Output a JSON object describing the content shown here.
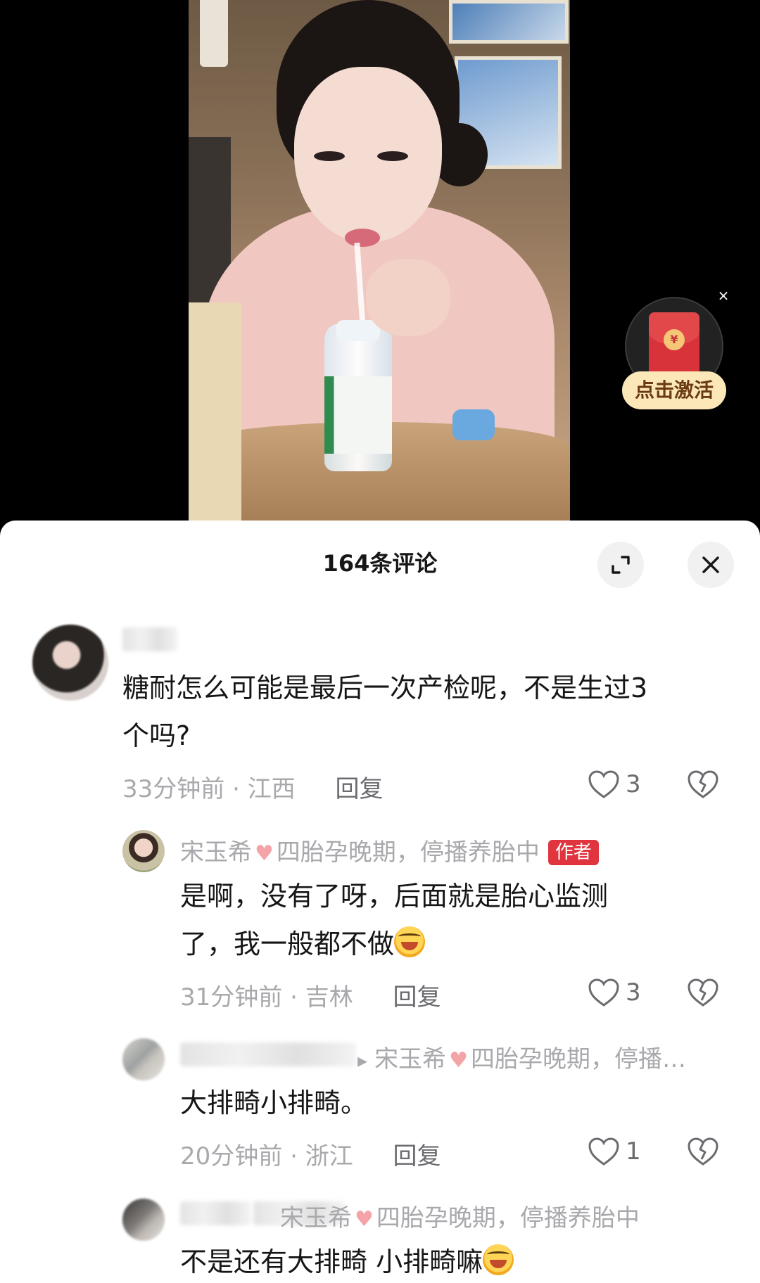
{
  "red_packet": {
    "label": "点击激活",
    "close": "×"
  },
  "comments_header": {
    "title": "164条评论"
  },
  "comments": [
    {
      "text_line1": "糖耐怎么可能是最后一次产检呢，不是生过3",
      "text_line2": "个吗?",
      "time": "33分钟前",
      "location": "江西",
      "reply": "回复",
      "likes": "3"
    },
    {
      "author_name": "宋玉希",
      "author_suffix": "四胎孕晚期，停播养胎中",
      "author_badge": "作者",
      "text_line1": "是啊，没有了呀，后面就是胎心监测",
      "text_line2": "了，我一般都不做",
      "time": "31分钟前",
      "location": "吉林",
      "reply": "回复",
      "likes": "3"
    },
    {
      "reply_to": "宋玉希",
      "reply_to_suffix": "四胎孕晚期，停播…",
      "text": "大排畸小排畸。",
      "time": "20分钟前",
      "location": "浙江",
      "reply": "回复",
      "likes": "1"
    },
    {
      "reply_to_partial": "宋玉希",
      "reply_to_suffix": "四胎孕晚期，停播养胎中",
      "text": "不是还有大排畸 小排畸嘛"
    }
  ],
  "colors": {
    "author_badge": "#e0343f",
    "meta_text": "#a9a9ad",
    "red_packet_label_bg": "#fbe7b8"
  }
}
